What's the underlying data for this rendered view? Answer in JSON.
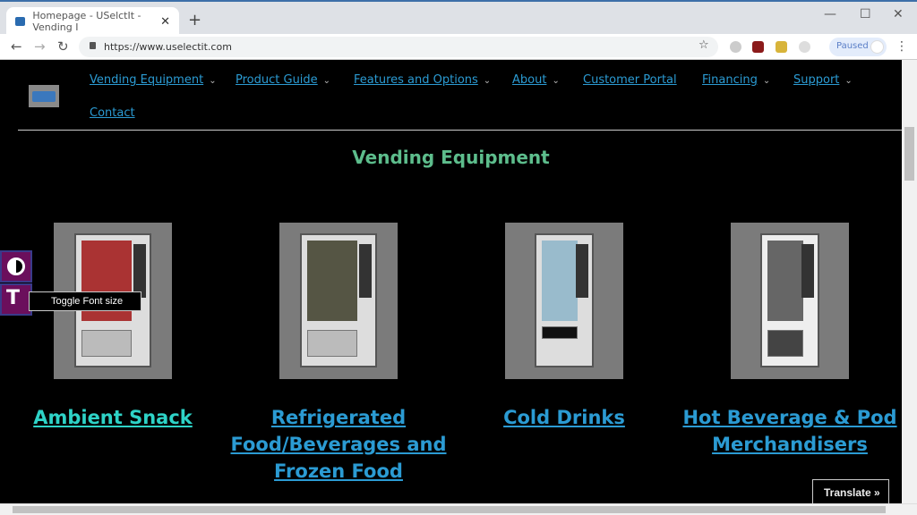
{
  "browser": {
    "tab_title": "Homepage - USelctIt - Vending I",
    "url": "https://www.uselectit.com",
    "profile_status": "Paused"
  },
  "nav": {
    "items": [
      {
        "label": "Vending Equipment",
        "dropdown": true
      },
      {
        "label": "Product Guide",
        "dropdown": true
      },
      {
        "label": "Features and Options",
        "dropdown": true
      },
      {
        "label": "About",
        "dropdown": true
      },
      {
        "label": "Customer Portal",
        "dropdown": false
      },
      {
        "label": "Financing",
        "dropdown": true
      },
      {
        "label": "Support",
        "dropdown": true
      },
      {
        "label": "Contact",
        "dropdown": false
      }
    ]
  },
  "main": {
    "heading": "Vending Equipment",
    "products": [
      {
        "title": "Ambient Snack"
      },
      {
        "title": "Refrigerated Food/Beverages and Frozen Food"
      },
      {
        "title": "Cold Drinks"
      },
      {
        "title": "Hot Beverage & Pod Merchandisers"
      }
    ]
  },
  "accessibility": {
    "tooltip": "Toggle Font size",
    "contrast_icon": "contrast-icon",
    "font_icon": "font-size-icon"
  },
  "translate": {
    "label": "Translate »"
  },
  "colors": {
    "nav_link": "#2b9bd3",
    "heading": "#5dbd8c",
    "visited_link": "#2ed3c7",
    "page_bg": "#000000"
  }
}
